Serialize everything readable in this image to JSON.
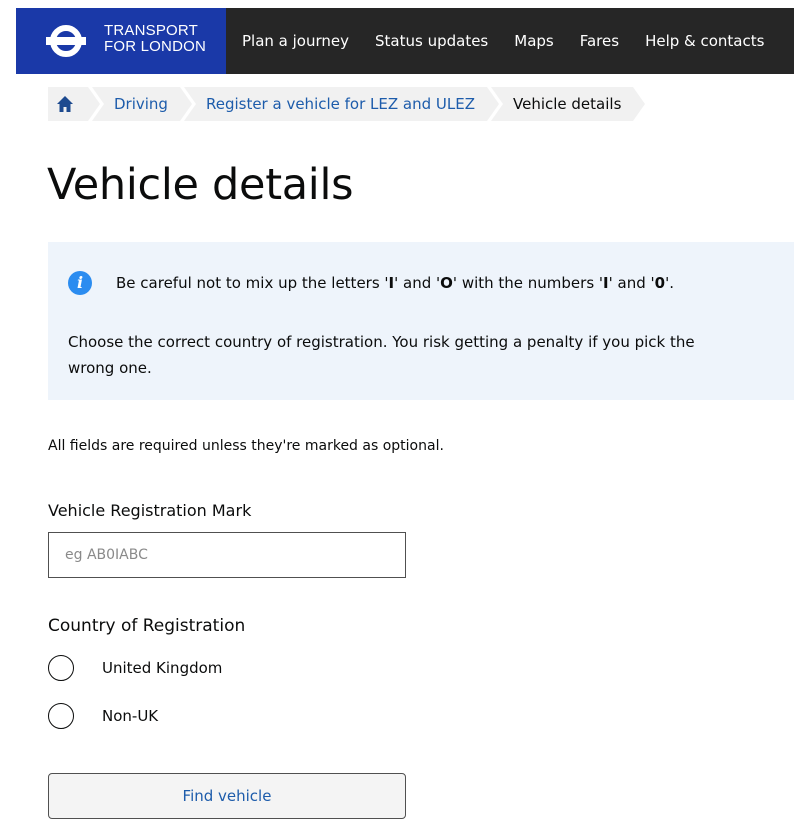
{
  "header": {
    "brand_line1": "TRANSPORT",
    "brand_line2": "FOR LONDON",
    "brand_color": "#1a39a8",
    "nav_color": "#262626",
    "nav": [
      "Plan a journey",
      "Status updates",
      "Maps",
      "Fares",
      "Help & contacts"
    ]
  },
  "breadcrumb": {
    "home_icon": "home-icon",
    "items": [
      "Driving",
      "Register a vehicle for LEZ and ULEZ"
    ],
    "current": "Vehicle details"
  },
  "page": {
    "title": "Vehicle details"
  },
  "info": {
    "icon": "info-icon",
    "p1_prefix": "Be careful not to mix up the letters '",
    "p1_l1": "I",
    "p1_mid1": "' and '",
    "p1_l2": "O",
    "p1_mid2": "' with the numbers '",
    "p1_n1": "I",
    "p1_mid3": "' and '",
    "p1_n2": "0",
    "p1_suffix": "'.",
    "p2": "Choose the correct country of registration. You risk getting a penalty if you pick the wrong one."
  },
  "form": {
    "required_note": "All fields are required unless they're marked as optional.",
    "vrm_label": "Vehicle Registration Mark",
    "vrm_placeholder": "eg AB0IABC",
    "vrm_value": "",
    "country_label": "Country of Registration",
    "country_options": [
      "United Kingdom",
      "Non-UK"
    ],
    "submit_label": "Find vehicle"
  }
}
